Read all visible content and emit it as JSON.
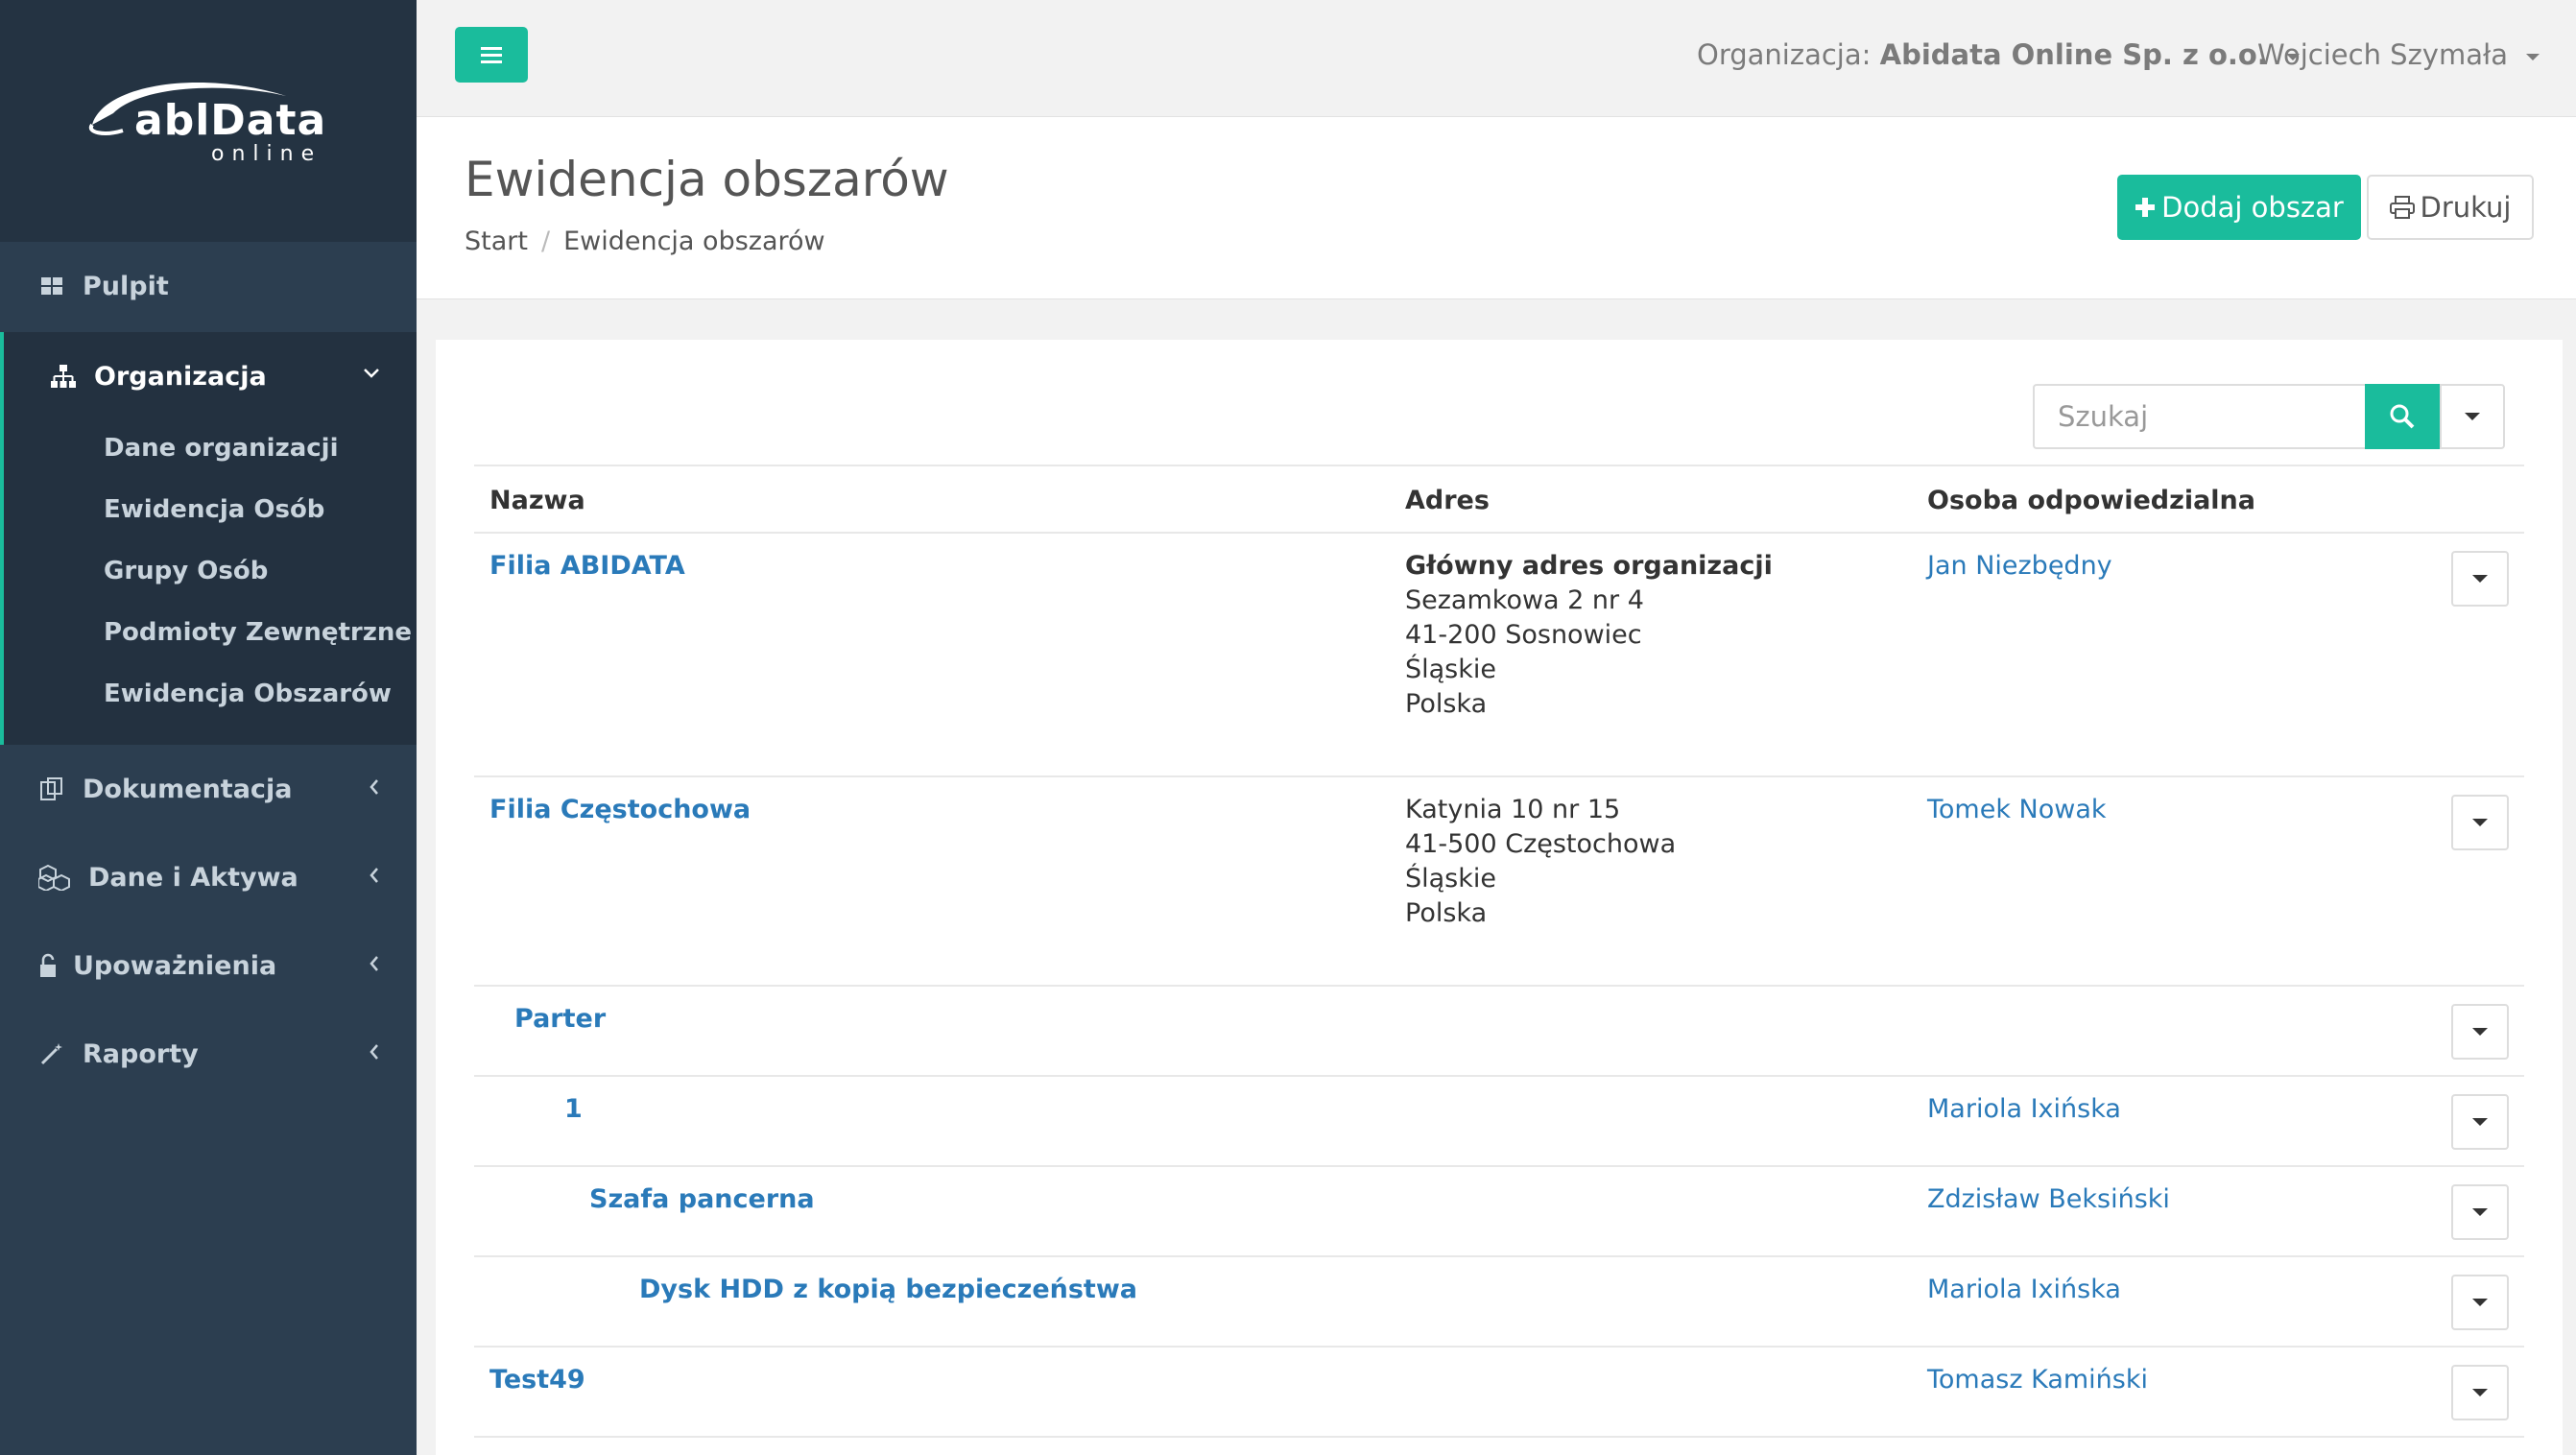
{
  "app": {
    "logo_text": "ablData",
    "logo_sub": "online"
  },
  "sidebar": {
    "items": [
      {
        "label": "Pulpit",
        "icon": "dashboard-icon"
      },
      {
        "label": "Organizacja",
        "icon": "sitemap-icon",
        "active": true
      },
      {
        "label": "Dokumentacja",
        "icon": "files-icon"
      },
      {
        "label": "Dane i Aktywa",
        "icon": "cubes-icon"
      },
      {
        "label": "Upoważnienia",
        "icon": "unlock-icon"
      },
      {
        "label": "Raporty",
        "icon": "magic-wand-icon"
      }
    ],
    "submenu": [
      {
        "label": "Dane organizacji"
      },
      {
        "label": "Ewidencja Osób"
      },
      {
        "label": "Grupy Osób"
      },
      {
        "label": "Podmioty Zewnętrzne"
      },
      {
        "label": "Ewidencja Obszarów"
      }
    ]
  },
  "header": {
    "org_prefix": "Organizacja:",
    "org_name": "Abidata Online Sp. z o.o.",
    "user_name": "Wojciech Szymała"
  },
  "page": {
    "title": "Ewidencja obszarów",
    "breadcrumb": [
      "Start",
      "Ewidencja obszarów"
    ],
    "add_button": "Dodaj obszar",
    "print_button": "Drukuj"
  },
  "search": {
    "placeholder": "Szukaj"
  },
  "table": {
    "columns": [
      "Nazwa",
      "Adres",
      "Osoba odpowiedzialna"
    ],
    "rows": [
      {
        "name": "Filia ABIDATA",
        "address_title": "Główny adres organizacji",
        "address_lines": [
          "Sezamkowa 2 nr 4",
          "41-200 Sosnowiec",
          "Śląskie",
          "Polska"
        ],
        "person": "Jan Niezbędny"
      },
      {
        "name": "Filia Częstochowa",
        "address_title": "",
        "address_lines": [
          "Katynia 10 nr 15",
          "41-500 Częstochowa",
          "Śląskie",
          "Polska"
        ],
        "person": "Tomek Nowak"
      },
      {
        "name": "Parter",
        "address_title": "",
        "address_lines": [],
        "person": ""
      },
      {
        "name": "1",
        "address_title": "",
        "address_lines": [],
        "person": "Mariola Ixińska"
      },
      {
        "name": "Szafa pancerna",
        "address_title": "",
        "address_lines": [],
        "person": "Zdzisław Beksiński"
      },
      {
        "name": "Dysk HDD z kopią bezpieczeństwa",
        "address_title": "",
        "address_lines": [],
        "person": "Mariola Ixińska"
      },
      {
        "name": "Test49",
        "address_title": "",
        "address_lines": [],
        "person": "Tomasz Kamiński"
      }
    ]
  },
  "colors": {
    "accent": "#1abc9c",
    "sidebar": "#2c3e50",
    "link": "#2a7ab9"
  }
}
